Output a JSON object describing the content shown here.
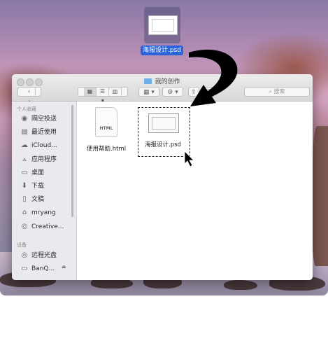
{
  "drag": {
    "file_label": "海报设计.psd"
  },
  "window": {
    "title": "我的创作",
    "search_placeholder": "搜索"
  },
  "sidebar": {
    "favorites_header": "个人收藏",
    "devices_header": "设备",
    "favorites": [
      {
        "label": "隔空投送",
        "icon": "airdrop-icon",
        "glyph": "◉"
      },
      {
        "label": "最近使用",
        "icon": "recents-icon",
        "glyph": "▤"
      },
      {
        "label": "iCloud...",
        "icon": "icloud-icon",
        "glyph": "☁"
      },
      {
        "label": "应用程序",
        "icon": "applications-icon",
        "glyph": "⟑"
      },
      {
        "label": "桌面",
        "icon": "desktop-icon",
        "glyph": "▭"
      },
      {
        "label": "下载",
        "icon": "downloads-icon",
        "glyph": "⬇"
      },
      {
        "label": "文稿",
        "icon": "documents-icon",
        "glyph": "▯"
      },
      {
        "label": "mryang",
        "icon": "home-icon",
        "glyph": "⌂"
      },
      {
        "label": "Creative...",
        "icon": "creative-cloud-icon",
        "glyph": "◎"
      }
    ],
    "devices": [
      {
        "label": "远程光盘",
        "icon": "remote-disc-icon",
        "glyph": "◎"
      },
      {
        "label": "BanQ...",
        "icon": "drive-icon",
        "glyph": "▭"
      }
    ]
  },
  "files": [
    {
      "name": "使用帮助.html",
      "badge": "HTML"
    },
    {
      "name": "海报设计.psd"
    }
  ]
}
